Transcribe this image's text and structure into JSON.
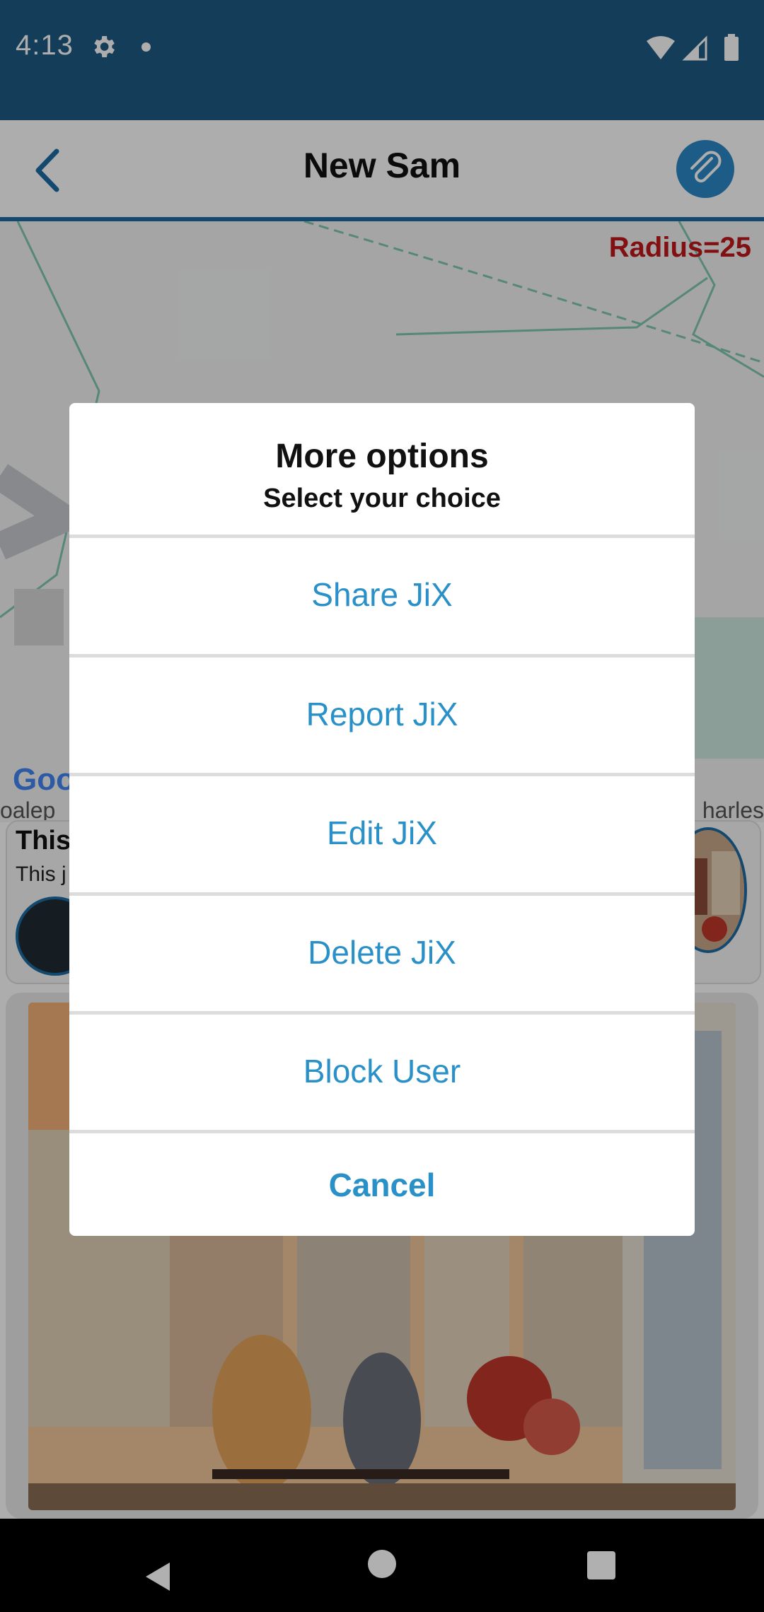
{
  "status_bar": {
    "time": "4:13"
  },
  "header": {
    "title": "New Sam"
  },
  "map": {
    "radius_label": "Radius=25",
    "google_text": "Goo",
    "google_text2": "oalep",
    "street_partial": "harles"
  },
  "post": {
    "title_partial": "This",
    "desc_partial": "This j"
  },
  "dialog": {
    "title": "More options",
    "subtitle": "Select your choice",
    "options": [
      {
        "label": "Share JiX"
      },
      {
        "label": "Report JiX"
      },
      {
        "label": "Edit JiX"
      },
      {
        "label": "Delete JiX"
      },
      {
        "label": "Block User"
      }
    ],
    "cancel_label": "Cancel"
  },
  "colors": {
    "status_bar": "#1c5a82",
    "accent": "#2a90c8",
    "radius_red": "#c0171a"
  }
}
